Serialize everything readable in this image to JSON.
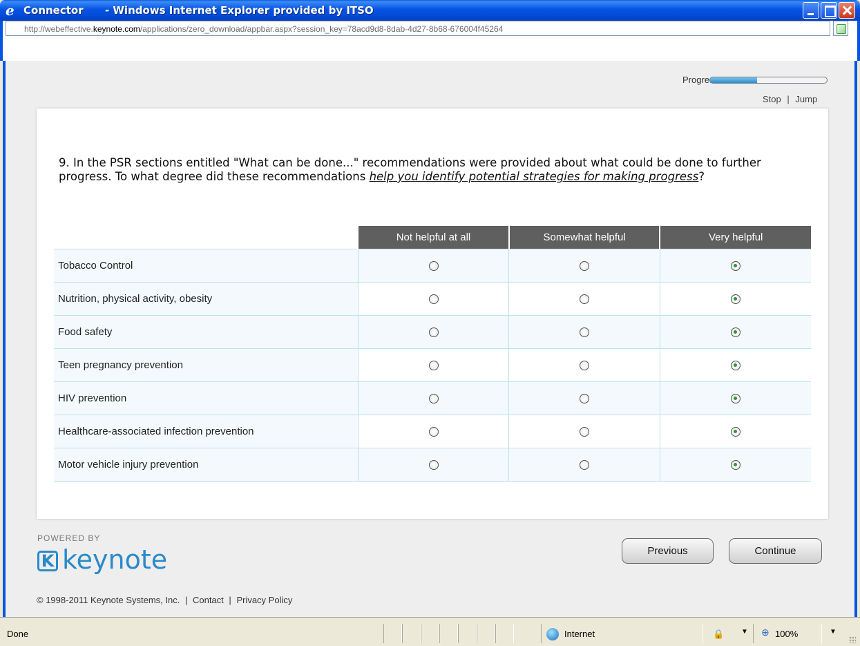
{
  "window": {
    "title": "Connector      - Windows Internet Explorer provided by ITSO"
  },
  "address": {
    "url_prefix": "http://webeffective.",
    "url_domain": "keynote.com",
    "url_rest": "/applications/zero_download/appbar.aspx?session_key=78acd9d8-8dab-4d27-8b68-676004f45264"
  },
  "progress": {
    "label": "Progress",
    "fraction": 0.4,
    "stop": "Stop",
    "separator": "|",
    "jump": "Jump"
  },
  "question": {
    "text_start": "9. In the PSR sections entitled \"What can be done...\" recommendations were provided about what could be done to further progress. To what degree did these recommendations ",
    "emphasis": "help you identify potential strategies for making progress",
    "text_end": "?"
  },
  "grid": {
    "columns": [
      "Not helpful at all",
      "Somewhat helpful",
      "Very helpful"
    ],
    "rows": [
      {
        "label": "Tobacco Control",
        "selected": 2
      },
      {
        "label": "Nutrition, physical activity, obesity",
        "selected": 2
      },
      {
        "label": "Food safety",
        "selected": 2
      },
      {
        "label": "Teen pregnancy prevention",
        "selected": 2
      },
      {
        "label": "HIV prevention",
        "selected": 2
      },
      {
        "label": "Healthcare-associated infection prevention",
        "selected": 2
      },
      {
        "label": "Motor vehicle injury prevention",
        "selected": 2
      }
    ]
  },
  "branding": {
    "powered_by": "POWERED BY",
    "logo_text": "keynote",
    "logo_mark": "K"
  },
  "buttons": {
    "previous": "Previous",
    "continue": "Continue"
  },
  "footer": {
    "copyright": "© 1998-2011 Keynote Systems, Inc.",
    "sep": "|",
    "contact": "Contact",
    "privacy": "Privacy Policy"
  },
  "status": {
    "text": "Done",
    "zone": "Internet",
    "zoom": "100%"
  },
  "colors": {
    "titlebar": "#0554e3",
    "header": "#5f5f5f",
    "accent": "#2a8ac8"
  }
}
